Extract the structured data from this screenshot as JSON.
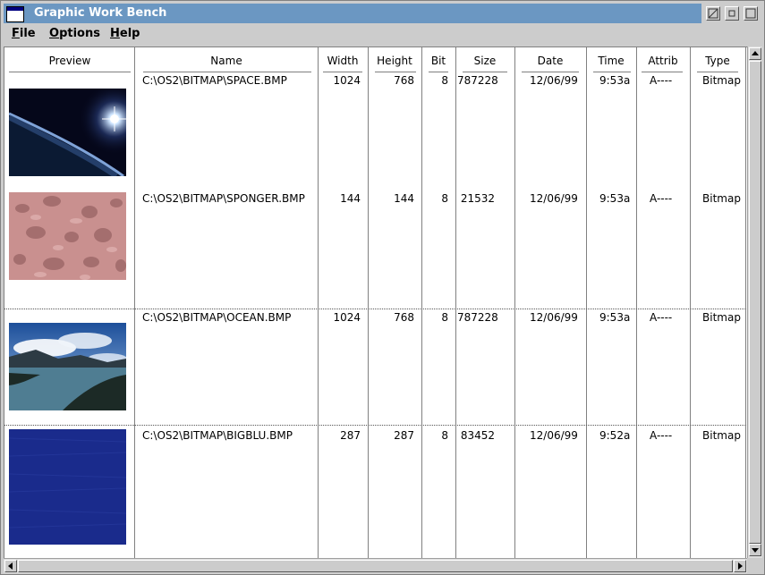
{
  "window": {
    "title": "Graphic Work Bench"
  },
  "menu": [
    {
      "mnemonic": "F",
      "rest": "ile"
    },
    {
      "mnemonic": "O",
      "rest": "ptions"
    },
    {
      "mnemonic": "H",
      "rest": "elp"
    }
  ],
  "columns": {
    "preview": "Preview",
    "name": "Name",
    "width": "Width",
    "height": "Height",
    "bit": "Bit",
    "size": "Size",
    "date": "Date",
    "time": "Time",
    "attrib": "Attrib",
    "type": "Type"
  },
  "files": [
    {
      "name": "C:\\OS2\\BITMAP\\SPACE.BMP",
      "width": "1024",
      "height": "768",
      "bit": "8",
      "size": "787228",
      "date": "12/06/99",
      "time": "9:53a",
      "attrib": "A----",
      "type": "Bitmap"
    },
    {
      "name": "C:\\OS2\\BITMAP\\SPONGER.BMP",
      "width": "144",
      "height": "144",
      "bit": "8",
      "size": "21532",
      "date": "12/06/99",
      "time": "9:53a",
      "attrib": "A----",
      "type": "Bitmap"
    },
    {
      "name": "C:\\OS2\\BITMAP\\OCEAN.BMP",
      "width": "1024",
      "height": "768",
      "bit": "8",
      "size": "787228",
      "date": "12/06/99",
      "time": "9:53a",
      "attrib": "A----",
      "type": "Bitmap"
    },
    {
      "name": "C:\\OS2\\BITMAP\\BIGBLU.BMP",
      "width": "287",
      "height": "287",
      "bit": "8",
      "size": "83452",
      "date": "12/06/99",
      "time": "9:52a",
      "attrib": "A----",
      "type": "Bitmap"
    }
  ],
  "colors": {
    "titlebar": "#6b97c2",
    "bigblu": "#1a2b8c",
    "sponger": "#c9908f"
  }
}
